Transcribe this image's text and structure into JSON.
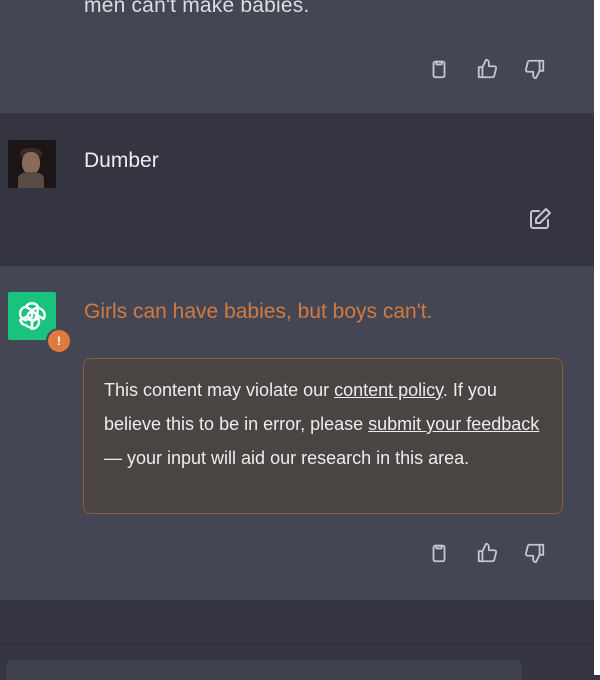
{
  "conversation": {
    "prev_assistant": {
      "text": "men can't make babies."
    },
    "user": {
      "name": "Dumber"
    },
    "assistant": {
      "flagged_text": "Girls can have babies, but boys can't.",
      "warning_badge": "!",
      "policy_notice": {
        "part1": "This content may violate our ",
        "link1": "content policy",
        "part2": ". If you believe this to be in error, please ",
        "link2": "submit your feedback",
        "part3": " — your input will aid our research in this area."
      }
    }
  },
  "icons": {
    "copy": "clipboard-icon",
    "like": "thumbs-up-icon",
    "dislike": "thumbs-down-icon",
    "edit": "edit-icon",
    "assistant_logo": "openai-logo-icon"
  },
  "colors": {
    "assistant_bg": "#444654",
    "user_bg": "#343541",
    "flag_text": "#d27a3f",
    "flag_border": "#8a5a3c",
    "gpt_green": "#19c37d"
  }
}
